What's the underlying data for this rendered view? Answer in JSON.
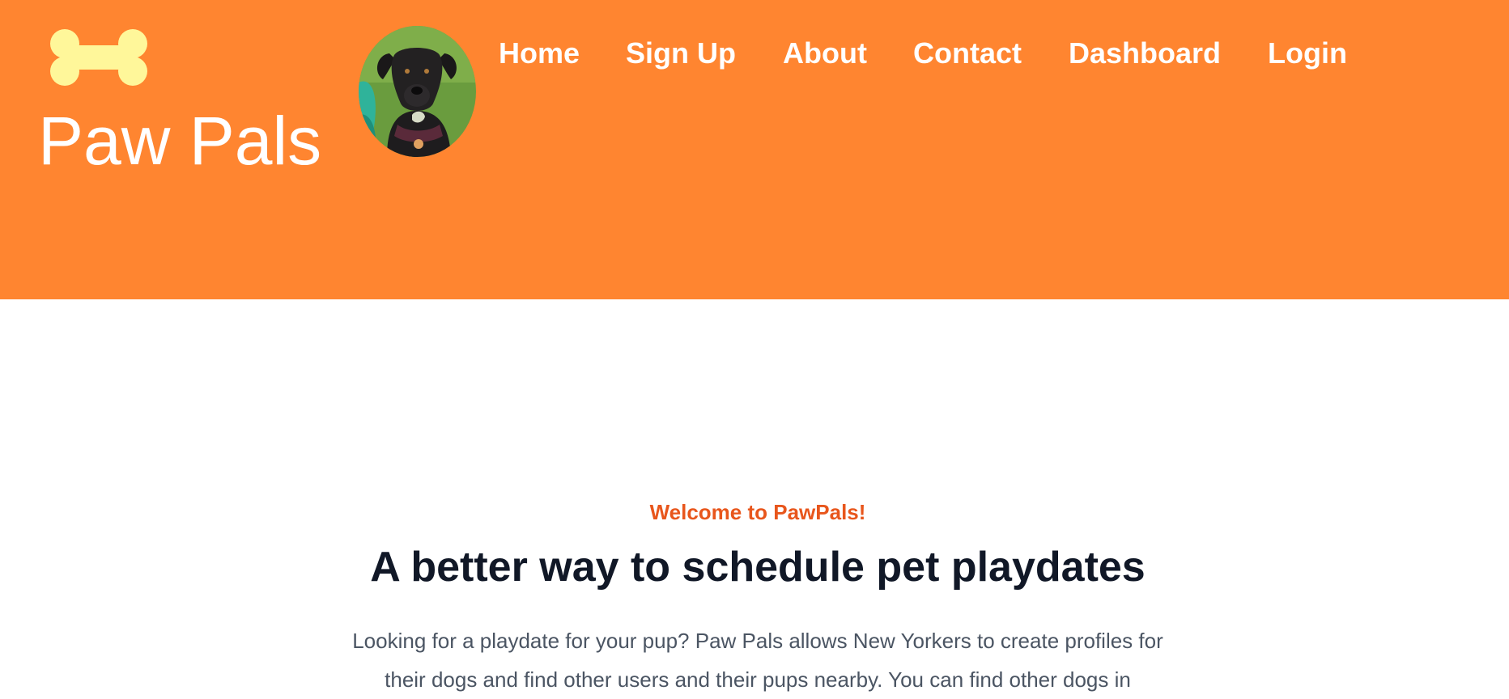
{
  "brand": {
    "logo_icon": "bone-icon",
    "logo_color": "#fff79a",
    "name": "Paw Pals",
    "avatar_alt": "dog-avatar"
  },
  "colors": {
    "header_bg": "#ff8530",
    "eyebrow": "#e8561c",
    "headline": "#111827",
    "body_text": "#4b5563"
  },
  "nav": {
    "items": [
      {
        "label": "Home"
      },
      {
        "label": "Sign Up"
      },
      {
        "label": "About"
      },
      {
        "label": "Contact"
      },
      {
        "label": "Dashboard"
      },
      {
        "label": "Login"
      }
    ]
  },
  "hero": {
    "eyebrow": "Welcome to PawPals!",
    "headline": "A better way to schedule pet playdates",
    "intro": "Looking for a playdate for your pup? Paw Pals allows New Yorkers to create profiles for their dogs and find other users and their pups nearby. You can find other dogs in"
  }
}
